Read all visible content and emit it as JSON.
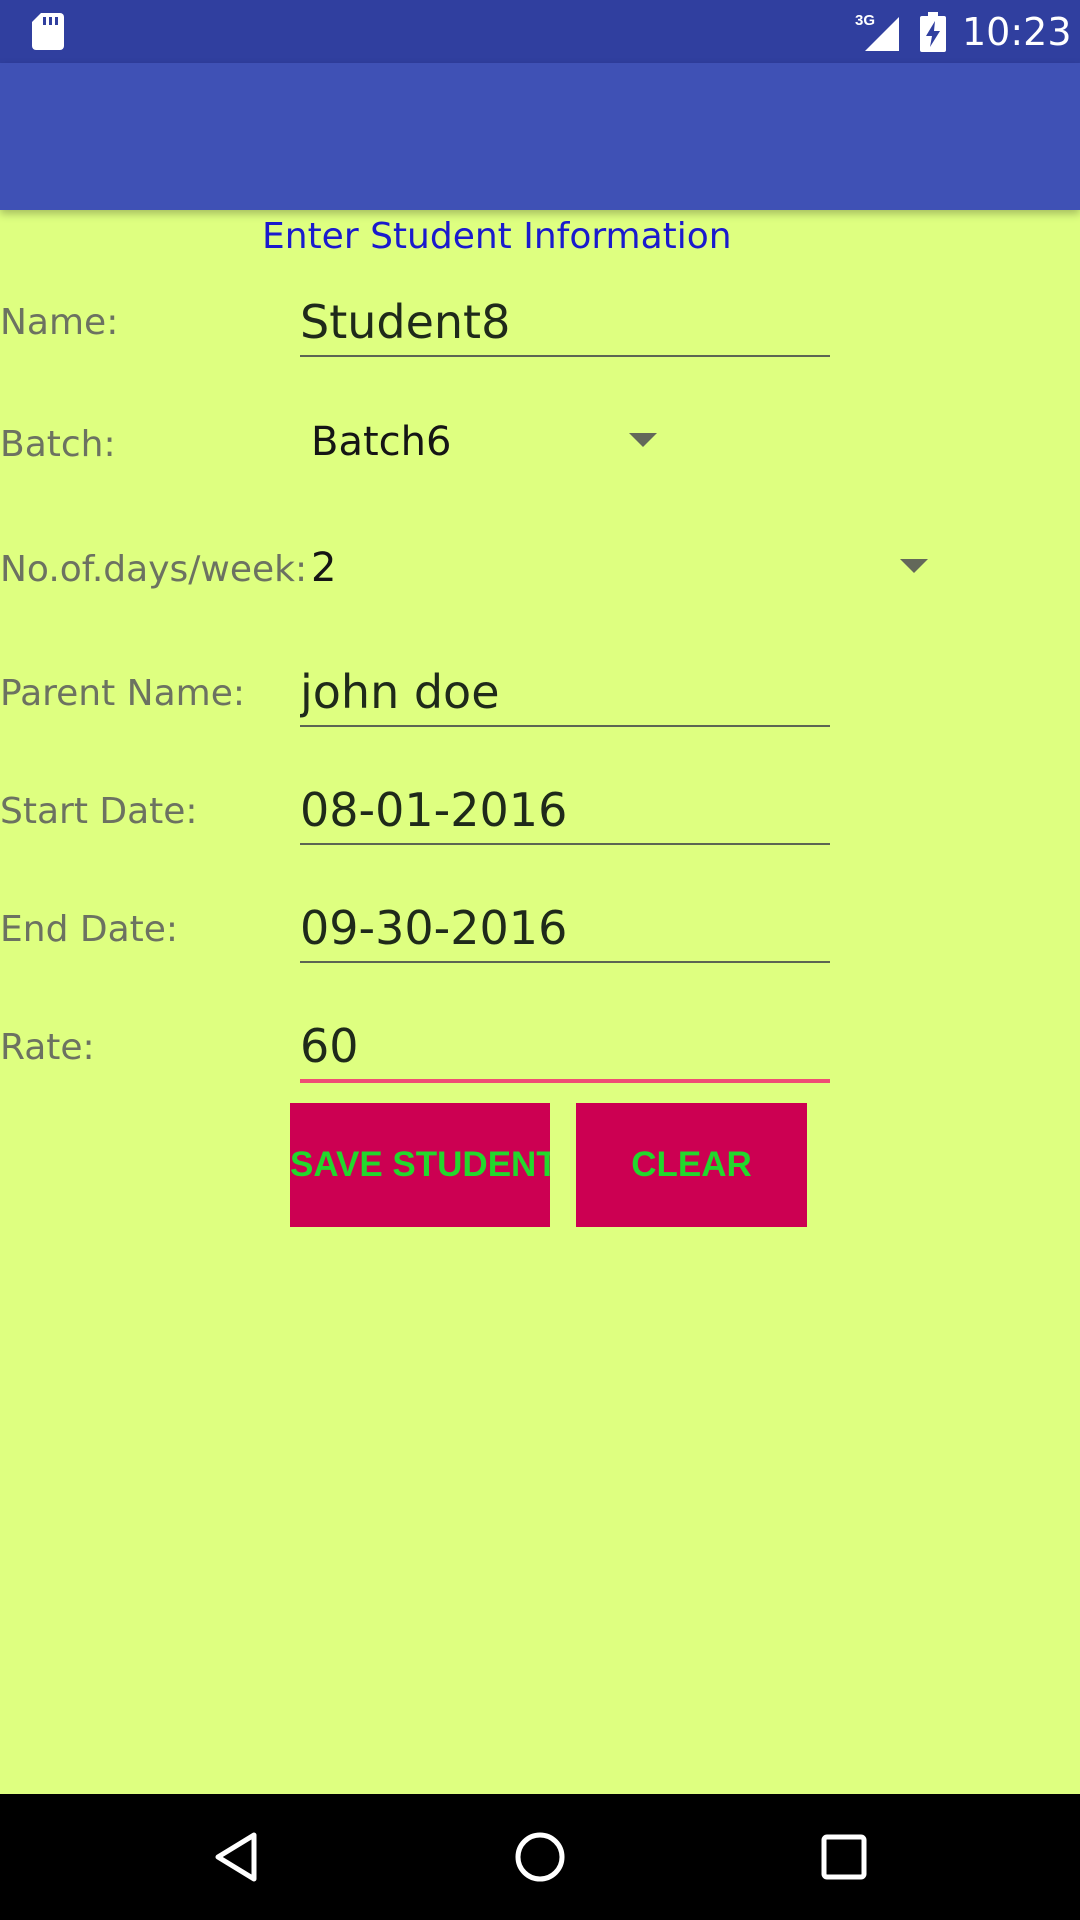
{
  "status_bar": {
    "time": "10:23",
    "network_label": "3G",
    "icons": [
      "sd-card-icon",
      "signal-3g-icon",
      "battery-charging-icon"
    ]
  },
  "colors": {
    "status_bar": "#303f9f",
    "app_bar": "#3f51b5",
    "background": "#deff80",
    "button_bg": "#cc0052",
    "button_text": "#22d82c",
    "title_text": "#1a1acd",
    "focus_underline": "#ef4d75"
  },
  "form": {
    "title": "Enter Student Information",
    "name": {
      "label": "Name:",
      "value": "Student8"
    },
    "batch": {
      "label": "Batch:",
      "value": "Batch6"
    },
    "days_per_week": {
      "label": "No.of.days/week:",
      "value": "2"
    },
    "parent_name": {
      "label": "Parent Name:",
      "value": "john doe"
    },
    "start_date": {
      "label": "Start Date:",
      "value": "08-01-2016"
    },
    "end_date": {
      "label": "End Date:",
      "value": "09-30-2016"
    },
    "rate": {
      "label": "Rate:",
      "value": "60"
    }
  },
  "actions": {
    "save_label": "SAVE STUDENT",
    "clear_label": "CLEAR"
  },
  "nav_bar": {
    "icons": [
      "back-icon",
      "home-icon",
      "recents-icon"
    ]
  }
}
